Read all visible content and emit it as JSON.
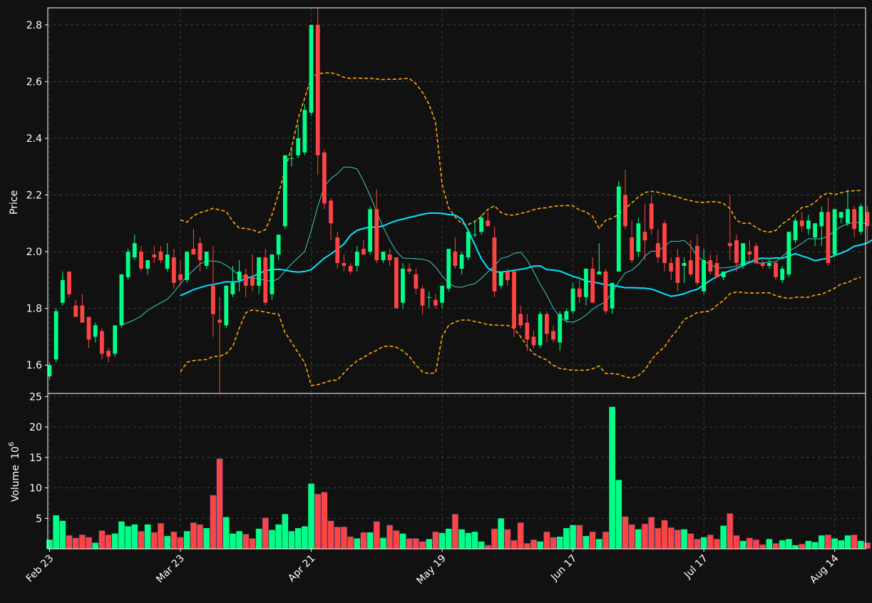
{
  "chart_data": [
    {
      "type": "candlestick",
      "ylabel": "Price",
      "ylim": [
        1.5,
        2.86
      ],
      "yticks": [
        1.6,
        1.8,
        2.0,
        2.2,
        2.4,
        2.6,
        2.8
      ],
      "grid": true,
      "colors": {
        "up": "#00ff88",
        "down": "#ff4444",
        "bollinger": "#ffa500",
        "ma_main": "#00e5ff",
        "ma_thin": "#40e0d0"
      },
      "series_note": "Daily OHLC candles with moving averages and Bollinger-style bands (estimated)"
    },
    {
      "type": "bar",
      "ylabel": "Volume",
      "ylabel_unit": "10",
      "ylabel_exp": "6",
      "ylim": [
        0,
        25.5
      ],
      "yticks": [
        5,
        10,
        15,
        20,
        25
      ],
      "grid": true
    }
  ],
  "xaxis": {
    "dates": [
      "Feb 23",
      "Mar 23",
      "Apr 21",
      "May 19",
      "Jun 17",
      "Jul 17",
      "Aug 14"
    ],
    "tick_index": [
      0,
      20,
      40,
      60,
      80,
      100,
      120
    ],
    "n_bars": 125
  },
  "candles": [
    [
      1.56,
      1.61,
      1.55,
      1.6
    ],
    [
      1.62,
      1.8,
      1.61,
      1.79
    ],
    [
      1.82,
      1.93,
      1.81,
      1.9
    ],
    [
      1.93,
      1.93,
      1.84,
      1.85
    ],
    [
      1.81,
      1.83,
      1.77,
      1.77
    ],
    [
      1.81,
      1.85,
      1.75,
      1.75
    ],
    [
      1.77,
      1.77,
      1.66,
      1.69
    ],
    [
      1.7,
      1.75,
      1.68,
      1.74
    ],
    [
      1.72,
      1.73,
      1.62,
      1.64
    ],
    [
      1.65,
      1.66,
      1.61,
      1.63
    ],
    [
      1.64,
      1.74,
      1.63,
      1.74
    ],
    [
      1.74,
      1.92,
      1.73,
      1.92
    ],
    [
      1.91,
      2.01,
      1.9,
      2.0
    ],
    [
      1.98,
      2.06,
      1.97,
      2.03
    ],
    [
      2.0,
      2.02,
      1.93,
      1.94
    ],
    [
      1.94,
      1.97,
      1.92,
      1.97
    ],
    [
      1.99,
      2.02,
      1.96,
      1.98
    ],
    [
      2.0,
      2.02,
      1.96,
      1.97
    ],
    [
      1.94,
      2.03,
      1.93,
      1.99
    ],
    [
      1.98,
      2.01,
      1.87,
      1.89
    ],
    [
      1.92,
      1.97,
      1.88,
      1.9
    ],
    [
      1.9,
      2.0,
      1.89,
      2.0
    ],
    [
      2.01,
      2.08,
      1.99,
      1.99
    ],
    [
      2.03,
      2.05,
      1.93,
      1.97
    ],
    [
      1.95,
      2.0,
      1.94,
      2.0
    ],
    [
      1.88,
      2.02,
      1.7,
      1.78
    ],
    [
      1.76,
      1.84,
      1.5,
      1.75
    ],
    [
      1.74,
      1.88,
      1.73,
      1.88
    ],
    [
      1.85,
      1.95,
      1.84,
      1.89
    ],
    [
      1.9,
      1.97,
      1.86,
      1.93
    ],
    [
      1.92,
      1.94,
      1.84,
      1.88
    ],
    [
      1.91,
      1.99,
      1.86,
      1.88
    ],
    [
      1.88,
      1.98,
      1.85,
      1.98
    ],
    [
      1.98,
      2.01,
      1.81,
      1.82
    ],
    [
      1.85,
      1.99,
      1.83,
      1.99
    ],
    [
      1.99,
      2.06,
      1.97,
      2.06
    ],
    [
      2.09,
      2.34,
      2.08,
      2.34
    ],
    [
      2.33,
      2.37,
      2.3,
      2.33
    ],
    [
      2.34,
      2.45,
      2.33,
      2.4
    ],
    [
      2.35,
      2.52,
      2.34,
      2.5
    ],
    [
      2.49,
      2.8,
      2.48,
      2.8
    ],
    [
      2.8,
      2.86,
      2.27,
      2.34
    ],
    [
      2.35,
      2.36,
      2.15,
      2.17
    ],
    [
      2.18,
      2.19,
      2.04,
      2.1
    ],
    [
      2.05,
      2.07,
      1.94,
      1.96
    ],
    [
      1.96,
      1.99,
      1.93,
      1.95
    ],
    [
      1.95,
      1.96,
      1.92,
      1.93
    ],
    [
      1.95,
      2.02,
      1.93,
      2.0
    ],
    [
      2.01,
      2.04,
      1.99,
      1.99
    ],
    [
      2.0,
      2.16,
      1.99,
      2.15
    ],
    [
      2.15,
      2.22,
      1.96,
      1.97
    ],
    [
      1.97,
      2.0,
      1.96,
      2.0
    ],
    [
      1.99,
      2.01,
      1.95,
      1.97
    ],
    [
      1.98,
      1.98,
      1.8,
      1.8
    ],
    [
      1.82,
      1.96,
      1.8,
      1.94
    ],
    [
      1.94,
      1.96,
      1.92,
      1.93
    ],
    [
      1.92,
      1.94,
      1.85,
      1.87
    ],
    [
      1.87,
      1.88,
      1.78,
      1.81
    ],
    [
      1.84,
      1.86,
      1.8,
      1.84
    ],
    [
      1.83,
      1.85,
      1.8,
      1.81
    ],
    [
      1.82,
      1.87,
      1.8,
      1.88
    ],
    [
      1.87,
      2.0,
      1.86,
      2.01
    ],
    [
      2.0,
      2.05,
      1.94,
      1.95
    ],
    [
      1.94,
      2.0,
      1.92,
      1.99
    ],
    [
      1.98,
      2.08,
      1.97,
      2.07
    ],
    [
      2.06,
      2.11,
      2.05,
      2.06
    ],
    [
      2.07,
      2.13,
      2.06,
      2.12
    ],
    [
      2.11,
      2.14,
      2.09,
      2.09
    ],
    [
      2.05,
      2.09,
      1.84,
      1.86
    ],
    [
      1.88,
      1.93,
      1.87,
      1.93
    ],
    [
      1.93,
      1.94,
      1.88,
      1.9
    ],
    [
      1.93,
      1.94,
      1.7,
      1.73
    ],
    [
      1.78,
      1.81,
      1.73,
      1.74
    ],
    [
      1.75,
      1.78,
      1.65,
      1.69
    ],
    [
      1.7,
      1.72,
      1.66,
      1.67
    ],
    [
      1.67,
      1.79,
      1.66,
      1.78
    ],
    [
      1.78,
      1.79,
      1.68,
      1.71
    ],
    [
      1.72,
      1.74,
      1.68,
      1.69
    ],
    [
      1.68,
      1.79,
      1.65,
      1.78
    ],
    [
      1.76,
      1.8,
      1.75,
      1.79
    ],
    [
      1.79,
      1.89,
      1.78,
      1.87
    ],
    [
      1.87,
      1.9,
      1.82,
      1.84
    ],
    [
      1.84,
      1.94,
      1.81,
      1.94
    ],
    [
      1.94,
      1.98,
      1.82,
      1.82
    ],
    [
      1.92,
      2.03,
      1.92,
      1.93
    ],
    [
      1.93,
      1.94,
      1.78,
      1.79
    ],
    [
      1.8,
      1.89,
      1.78,
      1.89
    ],
    [
      1.93,
      2.25,
      1.93,
      2.23
    ],
    [
      2.2,
      2.29,
      2.08,
      2.09
    ],
    [
      2.05,
      2.11,
      1.96,
      1.97
    ],
    [
      2.0,
      2.12,
      1.98,
      2.1
    ],
    [
      2.07,
      2.17,
      1.97,
      2.04
    ],
    [
      2.17,
      2.2,
      2.06,
      2.08
    ],
    [
      2.03,
      2.08,
      1.96,
      1.98
    ],
    [
      2.1,
      2.11,
      1.93,
      1.96
    ],
    [
      1.96,
      1.98,
      1.9,
      1.93
    ],
    [
      1.98,
      2.01,
      1.86,
      1.89
    ],
    [
      1.95,
      1.98,
      1.89,
      1.96
    ],
    [
      1.97,
      2.04,
      1.91,
      1.92
    ],
    [
      2.02,
      2.06,
      1.88,
      1.89
    ],
    [
      1.86,
      2.01,
      1.85,
      1.97
    ],
    [
      1.97,
      1.99,
      1.92,
      1.93
    ],
    [
      1.96,
      1.99,
      1.91,
      1.91
    ],
    [
      1.91,
      1.93,
      1.9,
      1.93
    ],
    [
      2.03,
      2.2,
      1.97,
      2.02
    ],
    [
      2.04,
      2.06,
      1.93,
      1.96
    ],
    [
      1.95,
      2.02,
      1.94,
      2.03
    ],
    [
      2.0,
      2.04,
      1.97,
      1.99
    ],
    [
      2.02,
      2.03,
      1.96,
      1.96
    ],
    [
      1.96,
      1.97,
      1.94,
      1.95
    ],
    [
      1.95,
      1.97,
      1.94,
      1.96
    ],
    [
      1.96,
      1.97,
      1.9,
      1.91
    ],
    [
      1.9,
      1.95,
      1.89,
      1.94
    ],
    [
      1.92,
      2.07,
      1.91,
      2.07
    ],
    [
      2.04,
      2.12,
      2.03,
      2.11
    ],
    [
      2.11,
      2.14,
      2.07,
      2.09
    ],
    [
      2.08,
      2.13,
      2.06,
      2.11
    ],
    [
      2.05,
      2.1,
      2.02,
      2.1
    ],
    [
      2.09,
      2.16,
      2.02,
      2.14
    ],
    [
      2.14,
      2.19,
      1.95,
      1.96
    ],
    [
      1.99,
      2.15,
      1.98,
      2.15
    ],
    [
      2.12,
      2.14,
      2.1,
      2.14
    ],
    [
      2.1,
      2.22,
      2.09,
      2.15
    ],
    [
      2.15,
      2.16,
      2.05,
      2.08
    ],
    [
      2.07,
      2.17,
      2.06,
      2.16
    ],
    [
      2.14,
      2.16,
      2.03,
      2.09
    ],
    [
      2.09,
      2.11,
      2.06,
      2.1
    ]
  ],
  "volumes": [
    1.5,
    5.5,
    4.6,
    2.2,
    1.8,
    2.3,
    1.9,
    1.0,
    3.0,
    2.3,
    2.5,
    4.5,
    3.7,
    4.0,
    2.9,
    4.0,
    2.7,
    4.2,
    2.1,
    2.8,
    1.9,
    2.9,
    4.3,
    4.0,
    3.4,
    8.8,
    14.8,
    5.2,
    2.5,
    2.9,
    2.4,
    1.7,
    3.3,
    5.1,
    3.1,
    4.0,
    5.7,
    2.9,
    3.4,
    3.7,
    10.7,
    9.0,
    9.3,
    4.6,
    3.6,
    3.6,
    2.0,
    1.7,
    2.7,
    2.7,
    4.5,
    1.8,
    3.9,
    3.0,
    2.5,
    1.7,
    1.7,
    1.2,
    1.6,
    2.8,
    2.6,
    3.3,
    5.7,
    3.2,
    2.6,
    2.8,
    1.2,
    0.6,
    3.3,
    5.0,
    3.2,
    1.4,
    4.3,
    0.9,
    1.5,
    1.2,
    2.8,
    1.9,
    2.0,
    3.4,
    3.9,
    3.9,
    2.1,
    2.8,
    1.6,
    2.8,
    23.3,
    11.3,
    5.3,
    4.0,
    3.2,
    4.1,
    5.2,
    3.4,
    4.7,
    3.5,
    3.1,
    3.2,
    2.5,
    1.6,
    1.9,
    2.3,
    1.6,
    3.8,
    5.8,
    2.2,
    1.3,
    1.8,
    1.5,
    0.7,
    1.6,
    0.9,
    1.4,
    1.6,
    0.6,
    0.8,
    1.3,
    1.1,
    2.2,
    2.3,
    1.7,
    1.4,
    2.2,
    2.3,
    1.3,
    1.0
  ],
  "ma_main": [
    null,
    null,
    null,
    null,
    null,
    null,
    null,
    null,
    null,
    null,
    null,
    null,
    null,
    null,
    null,
    null,
    null,
    null,
    null,
    null,
    1.845,
    1.855,
    1.866,
    1.873,
    1.88,
    1.884,
    1.889,
    1.894,
    1.893,
    1.896,
    1.905,
    1.912,
    1.923,
    1.933,
    1.937,
    1.938,
    1.935,
    1.93,
    1.928,
    1.93,
    1.937,
    1.957,
    1.977,
    1.992,
    2.009,
    2.027,
    2.058,
    2.075,
    2.082,
    2.087,
    2.086,
    2.091,
    2.101,
    2.109,
    2.115,
    2.121,
    2.126,
    2.132,
    2.136,
    2.136,
    2.135,
    2.131,
    2.129,
    2.115,
    2.074,
    2.025,
    1.975,
    1.942,
    1.929,
    1.928,
    1.931,
    1.934,
    1.938,
    1.942,
    1.949,
    1.95,
    1.937,
    1.935,
    1.932,
    1.922,
    1.913,
    1.906,
    1.897,
    1.893,
    1.889,
    1.883,
    1.882,
    1.877,
    1.873,
    1.873,
    1.872,
    1.871,
    1.868,
    1.86,
    1.851,
    1.843,
    1.846,
    1.852,
    1.861,
    1.867,
    1.883,
    1.899,
    1.912,
    1.924,
    1.933,
    1.94,
    1.952,
    1.962,
    1.974,
    1.977,
    1.976,
    1.978,
    1.977,
    1.985,
    1.993,
    1.985,
    1.978,
    1.968,
    1.973,
    1.977,
    1.987,
    1.995,
    2.005,
    2.019,
    2.024,
    2.031,
    2.045,
    2.051,
    2.052,
    2.061
  ],
  "ma_thin": [
    null,
    null,
    null,
    null,
    null,
    null,
    null,
    null,
    null,
    null,
    null,
    1.74,
    1.75,
    1.76,
    1.773,
    1.793,
    1.807,
    1.82,
    1.832,
    1.857,
    1.887,
    1.912,
    1.935,
    1.957,
    1.968,
    1.967,
    1.964,
    1.952,
    1.935,
    1.917,
    1.91,
    1.908,
    1.903,
    1.9,
    1.895,
    1.905,
    1.932,
    1.957,
    1.979,
    2.001,
    2.075,
    2.16,
    2.23,
    2.258,
    2.275,
    2.299,
    2.298,
    2.292,
    2.248,
    2.198,
    2.141,
    2.086,
    2.04,
    2.001,
    1.978,
    1.976,
    1.975,
    1.973,
    1.967,
    1.946,
    1.915,
    1.888,
    1.876,
    1.874,
    1.882,
    1.887,
    1.906,
    1.929,
    1.95,
    1.976,
    1.982,
    1.994,
    1.998,
    1.97,
    1.93,
    1.885,
    1.847,
    1.801,
    1.768,
    1.754,
    1.751,
    1.761,
    1.776,
    1.797,
    1.812,
    1.822,
    1.856,
    1.894,
    1.925,
    1.935,
    1.954,
    1.984,
    2.002,
    2.002,
    2.02,
    2.037,
    2.036,
    2.04,
    2.019,
    1.983,
    1.967,
    1.955,
    1.943,
    1.943,
    1.945,
    1.949,
    1.961,
    1.966,
    1.96,
    1.96,
    1.964,
    1.963,
    1.983,
    2.003,
    2.014,
    2.03,
    2.046,
    2.045,
    2.046,
    2.055,
    2.074,
    2.089,
    2.098,
    2.104,
    2.102,
    2.098
  ],
  "band_upper": [
    null,
    null,
    null,
    null,
    null,
    null,
    null,
    null,
    null,
    null,
    null,
    null,
    null,
    null,
    null,
    null,
    null,
    null,
    null,
    null,
    2.112,
    2.104,
    2.127,
    2.138,
    2.144,
    2.153,
    2.147,
    2.142,
    2.107,
    2.083,
    2.082,
    2.077,
    2.068,
    2.078,
    2.13,
    2.205,
    2.289,
    2.368,
    2.47,
    2.542,
    2.615,
    2.628,
    2.63,
    2.631,
    2.625,
    2.615,
    2.611,
    2.613,
    2.611,
    2.612,
    2.609,
    2.607,
    2.608,
    2.608,
    2.61,
    2.611,
    2.592,
    2.562,
    2.52,
    2.457,
    2.236,
    2.155,
    2.122,
    2.099,
    2.096,
    2.106,
    2.125,
    2.149,
    2.162,
    2.138,
    2.13,
    2.129,
    2.135,
    2.14,
    2.148,
    2.153,
    2.155,
    2.16,
    2.162,
    2.163,
    2.162,
    2.147,
    2.14,
    2.125,
    2.082,
    2.111,
    2.118,
    2.132,
    2.152,
    2.172,
    2.193,
    2.209,
    2.213,
    2.21,
    2.204,
    2.199,
    2.193,
    2.185,
    2.18,
    2.175,
    2.174,
    2.176,
    2.176,
    2.17,
    2.152,
    2.11,
    2.1,
    2.101,
    2.085,
    2.073,
    2.069,
    2.075,
    2.098,
    2.114,
    2.135,
    2.156,
    2.16,
    2.174,
    2.197,
    2.208,
    2.201,
    2.208,
    2.213,
    2.215,
    2.216
  ],
  "band_lower": [
    null,
    null,
    null,
    null,
    null,
    null,
    null,
    null,
    null,
    null,
    null,
    null,
    null,
    null,
    null,
    null,
    null,
    null,
    null,
    null,
    1.576,
    1.61,
    1.616,
    1.618,
    1.62,
    1.63,
    1.631,
    1.641,
    1.666,
    1.73,
    1.785,
    1.795,
    1.791,
    1.787,
    1.782,
    1.78,
    1.715,
    1.68,
    1.643,
    1.609,
    1.528,
    1.531,
    1.538,
    1.546,
    1.547,
    1.573,
    1.596,
    1.615,
    1.627,
    1.642,
    1.652,
    1.666,
    1.667,
    1.663,
    1.65,
    1.63,
    1.6,
    1.576,
    1.57,
    1.573,
    1.7,
    1.74,
    1.753,
    1.759,
    1.759,
    1.754,
    1.749,
    1.743,
    1.741,
    1.74,
    1.74,
    1.729,
    1.7,
    1.667,
    1.64,
    1.628,
    1.618,
    1.599,
    1.588,
    1.585,
    1.582,
    1.582,
    1.582,
    1.587,
    1.597,
    1.57,
    1.57,
    1.567,
    1.559,
    1.554,
    1.563,
    1.583,
    1.619,
    1.645,
    1.664,
    1.698,
    1.725,
    1.761,
    1.772,
    1.785,
    1.788,
    1.791,
    1.811,
    1.828,
    1.852,
    1.858,
    1.856,
    1.854,
    1.854,
    1.855,
    1.855,
    1.845,
    1.839,
    1.835,
    1.839,
    1.839,
    1.839,
    1.847,
    1.85,
    1.86,
    1.871,
    1.887,
    1.891,
    1.903,
    1.91
  ]
}
